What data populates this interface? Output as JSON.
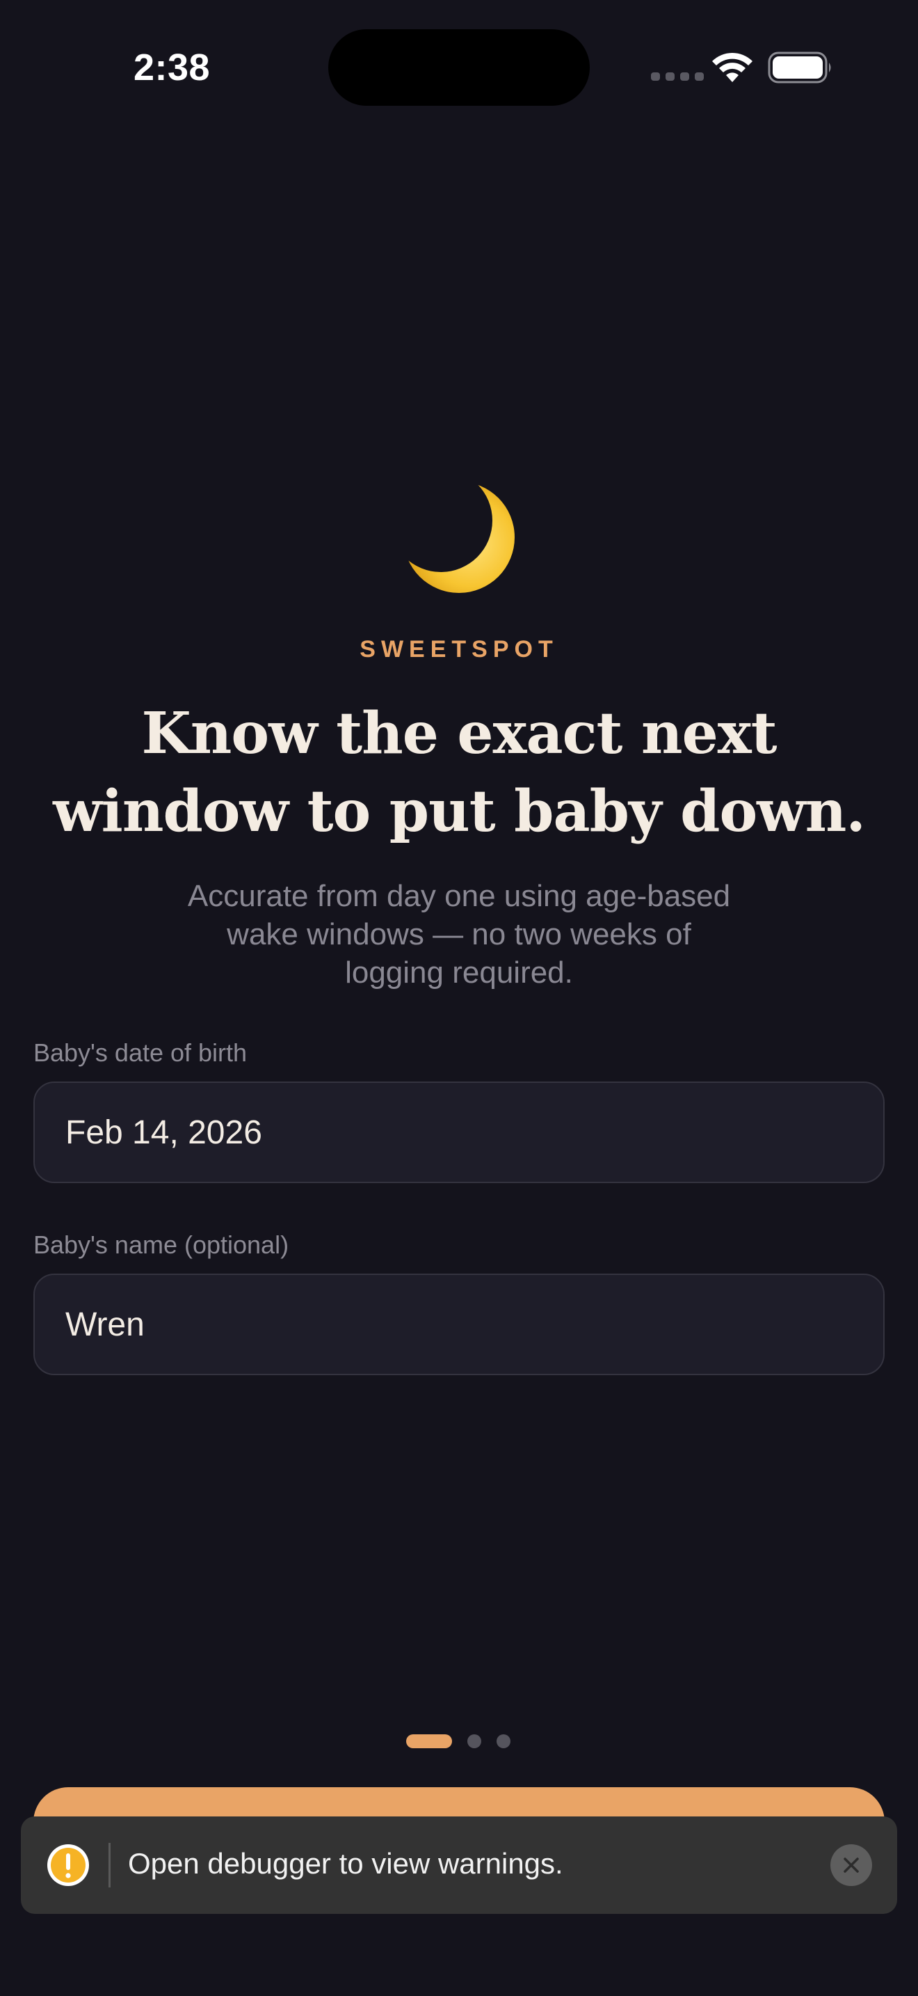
{
  "status_bar": {
    "time": "2:38"
  },
  "hero": {
    "icon": "crescent-moon-icon",
    "brand": "SWEETSPOT",
    "headline_line1": "Know the exact next",
    "headline_line2": "window to put baby down.",
    "subhead_line1": "Accurate from day one using age-based",
    "subhead_line2": "wake windows — no two weeks of",
    "subhead_line3": "logging required."
  },
  "form": {
    "dob": {
      "label": "Baby's date of birth",
      "value": "Feb 14, 2026"
    },
    "name": {
      "label": "Baby's name (optional)",
      "value": "Wren"
    }
  },
  "pager": {
    "current": 1,
    "total": 3
  },
  "toast": {
    "message": "Open debugger to view warnings.",
    "icon": "warning-icon"
  },
  "colors": {
    "background": "#14131c",
    "accent": "#e9a466",
    "field_bg": "#1e1d29",
    "warning": "#f6b325"
  }
}
